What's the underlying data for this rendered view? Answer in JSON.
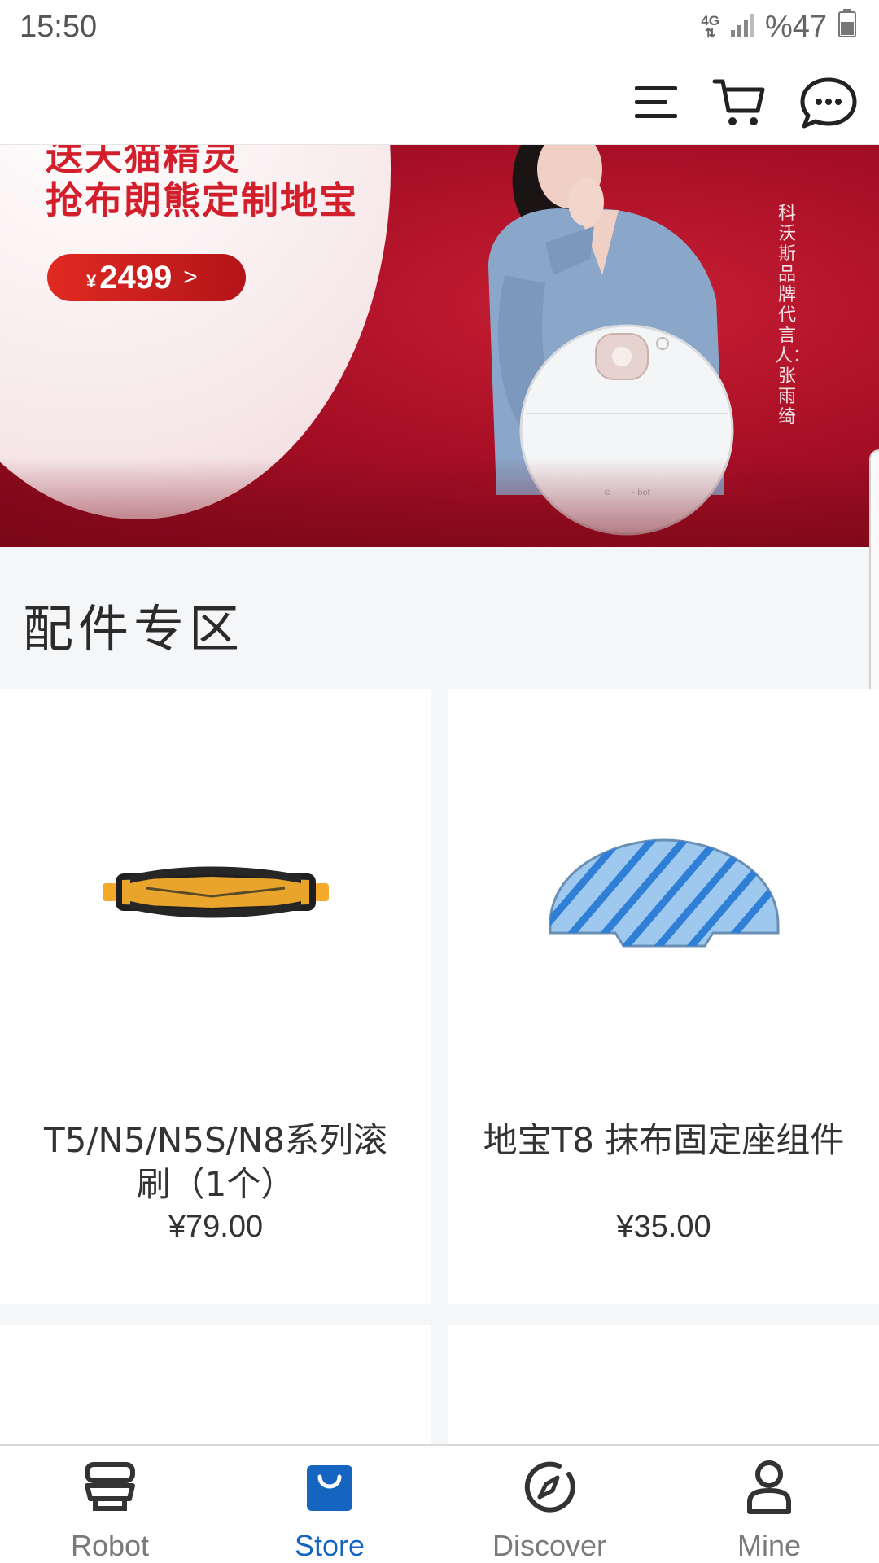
{
  "status_bar": {
    "time": "15:50",
    "network": "4G",
    "battery": "%47"
  },
  "app_bar": {
    "icons": [
      "menu-icon",
      "cart-icon",
      "chat-icon"
    ]
  },
  "banner": {
    "line1": "送天猫精灵",
    "line2": "抢布朗熊定制地宝",
    "price_currency": "¥",
    "price": "2499",
    "price_arrow": ">",
    "spokesperson": "科沃斯品牌代言人：张雨绮"
  },
  "section": {
    "title": "配件专区"
  },
  "products": [
    {
      "name": "T5/N5/N5S/N8系列滚刷（1个）",
      "price": "¥79.00"
    },
    {
      "name": "地宝T8 抹布固定座组件",
      "price": "¥35.00"
    }
  ],
  "bottom_nav": {
    "items": [
      {
        "label": "Robot",
        "active": false
      },
      {
        "label": "Store",
        "active": true
      },
      {
        "label": "Discover",
        "active": false
      },
      {
        "label": "Mine",
        "active": false
      }
    ]
  },
  "colors": {
    "accent": "#1565c0",
    "banner_red": "#a90f26",
    "inactive": "#7a7a7a"
  }
}
